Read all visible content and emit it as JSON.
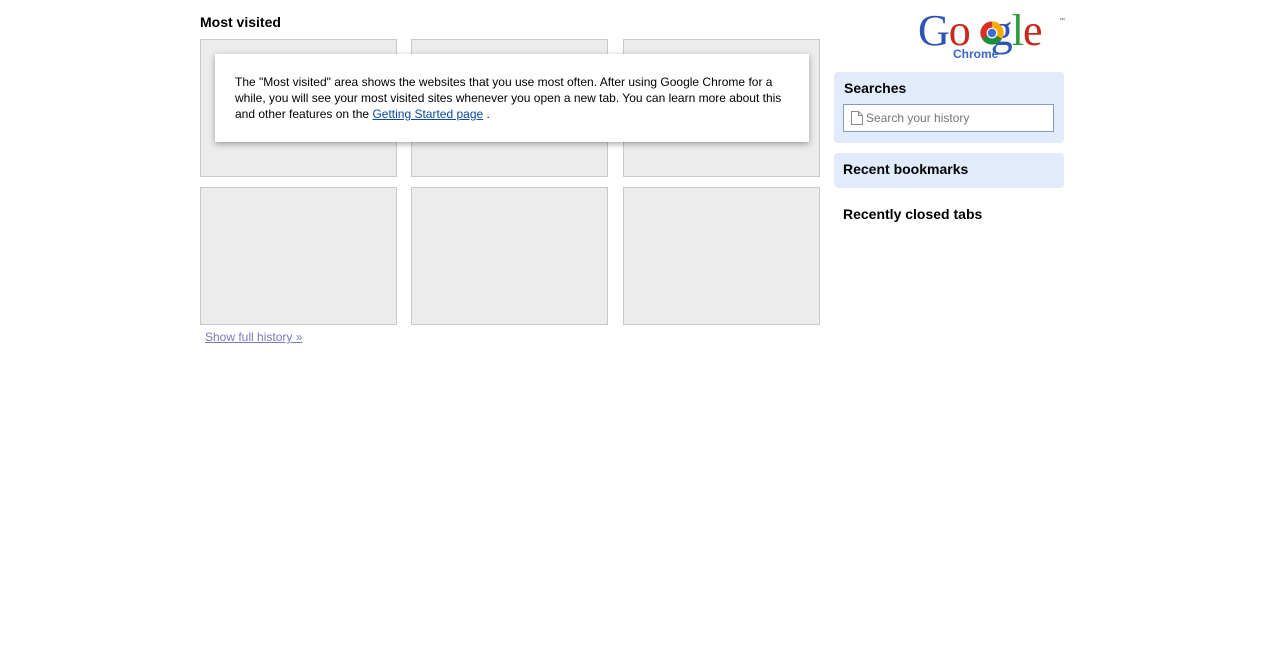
{
  "most_visited": {
    "heading": "Most visited",
    "notice": {
      "text": "The \"Most visited\" area shows the websites that you use most often. After using Google Chrome for a while, you will see your most visited sites whenever you open a new tab. You can learn more about this and other features on the ",
      "link_label": "Getting Started page",
      "suffix": " ."
    },
    "show_history_label": "Show full history »"
  },
  "logo": {
    "letters": [
      "G",
      "o",
      "o",
      "g",
      "l",
      "e"
    ],
    "subtitle": "Chrome",
    "trademark": "™"
  },
  "sidebar": {
    "searches_title": "Searches",
    "search_placeholder": "Search your history",
    "recent_bookmarks_title": "Recent bookmarks",
    "recently_closed_title": "Recently closed tabs"
  },
  "colors": {
    "panel_bg": "#e1ebfc",
    "thumbnail_bg": "#ececec",
    "link": "#0b4aa2",
    "visited_link": "#7b78c4"
  },
  "icons": [
    "chrome-logo-icon",
    "document-icon"
  ]
}
